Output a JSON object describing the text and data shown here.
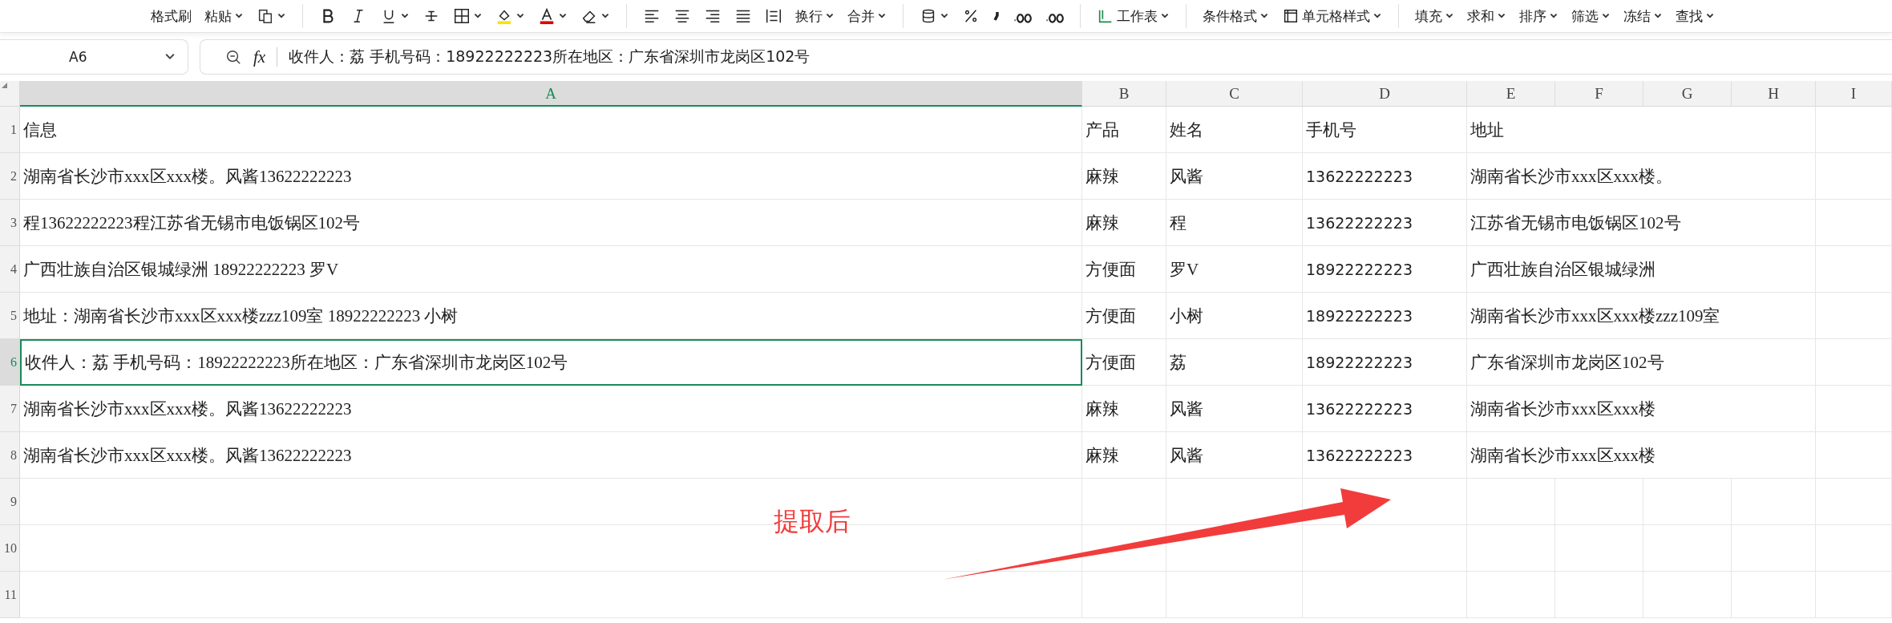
{
  "toolbar": [
    {
      "kind": "text",
      "label": "格式刷",
      "caret": false
    },
    {
      "kind": "text",
      "label": "粘贴",
      "caret": true
    },
    {
      "kind": "paste",
      "caret": true
    },
    {
      "kind": "sep"
    },
    {
      "kind": "bold",
      "caret": false
    },
    {
      "kind": "italic",
      "caret": false
    },
    {
      "kind": "underline",
      "caret": true
    },
    {
      "kind": "strike",
      "caret": false
    },
    {
      "kind": "border",
      "caret": true
    },
    {
      "kind": "fill",
      "caret": true
    },
    {
      "kind": "fontcolor",
      "caret": true
    },
    {
      "kind": "eraser",
      "caret": true
    },
    {
      "kind": "sep"
    },
    {
      "kind": "alignleft",
      "caret": false
    },
    {
      "kind": "aligncenter",
      "caret": false
    },
    {
      "kind": "alignright",
      "caret": false
    },
    {
      "kind": "justify",
      "caret": false
    },
    {
      "kind": "distribute",
      "caret": false
    },
    {
      "kind": "text",
      "label": "换行",
      "caret": true
    },
    {
      "kind": "text",
      "label": "合并",
      "caret": true
    },
    {
      "kind": "sep"
    },
    {
      "kind": "stack",
      "caret": true
    },
    {
      "kind": "percent",
      "caret": false
    },
    {
      "kind": "comma",
      "caret": false
    },
    {
      "kind": "decimal",
      "caret": false
    },
    {
      "kind": "decimal",
      "caret": false
    },
    {
      "kind": "sep"
    },
    {
      "kind": "sheet",
      "label": "工作表",
      "caret": true
    },
    {
      "kind": "sep"
    },
    {
      "kind": "text",
      "label": "条件格式",
      "caret": true
    },
    {
      "kind": "cellstyle",
      "label": "单元格样式",
      "caret": true
    },
    {
      "kind": "sep"
    },
    {
      "kind": "text",
      "label": "填充",
      "caret": true
    },
    {
      "kind": "text",
      "label": "求和",
      "caret": true
    },
    {
      "kind": "text",
      "label": "排序",
      "caret": true
    },
    {
      "kind": "text",
      "label": "筛选",
      "caret": true
    },
    {
      "kind": "text",
      "label": "冻结",
      "caret": true
    },
    {
      "kind": "text",
      "label": "查找",
      "caret": true
    }
  ],
  "name_box": "A6",
  "formula": {
    "fx": "fx",
    "value": "收件人：荔 手机号码：18922222223所在地区：广东省深圳市龙岗区102号"
  },
  "columns": [
    {
      "label": "A",
      "selected": true
    },
    {
      "label": "B",
      "selected": false
    },
    {
      "label": "C",
      "selected": false
    },
    {
      "label": "D",
      "selected": false
    },
    {
      "label": "E",
      "selected": false
    },
    {
      "label": "F",
      "selected": false
    },
    {
      "label": "G",
      "selected": false
    },
    {
      "label": "H",
      "selected": false
    },
    {
      "label": "I",
      "selected": false
    }
  ],
  "rows": [
    {
      "number": "1",
      "selected": false,
      "cells": [
        "信息",
        "产品",
        "姓名",
        "手机号",
        "地址"
      ]
    },
    {
      "number": "2",
      "selected": false,
      "cells": [
        "湖南省长沙市xxx区xxx楼。风酱13622222223",
        "麻辣",
        "风酱",
        "13622222223",
        "湖南省长沙市xxx区xxx楼。"
      ]
    },
    {
      "number": "3",
      "selected": false,
      "cells": [
        "程13622222223程江苏省无锡市电饭锅区102号",
        "麻辣",
        "程",
        "13622222223",
        "江苏省无锡市电饭锅区102号"
      ]
    },
    {
      "number": "4",
      "selected": false,
      "cells": [
        "广西壮族自治区银城绿洲 18922222223 罗V",
        "方便面",
        "罗V",
        "18922222223",
        "广西壮族自治区银城绿洲"
      ]
    },
    {
      "number": "5",
      "selected": false,
      "cells": [
        "地址：湖南省长沙市xxx区xxx楼zzz109室    18922222223 小树",
        "方便面",
        "小树",
        "18922222223",
        "湖南省长沙市xxx区xxx楼zzz109室"
      ]
    },
    {
      "number": "6",
      "selected": true,
      "cells": [
        "收件人：荔 手机号码：18922222223所在地区：广东省深圳市龙岗区102号",
        "方便面",
        "荔",
        "18922222223",
        "广东省深圳市龙岗区102号"
      ]
    },
    {
      "number": "7",
      "selected": false,
      "cells": [
        "湖南省长沙市xxx区xxx楼。风酱13622222223",
        "麻辣",
        "风酱",
        "13622222223",
        "湖南省长沙市xxx区xxx楼"
      ]
    },
    {
      "number": "8",
      "selected": false,
      "cells": [
        "湖南省长沙市xxx区xxx楼。风酱13622222223",
        "麻辣",
        "风酱",
        "13622222223",
        "湖南省长沙市xxx区xxx楼"
      ]
    },
    {
      "number": "9",
      "selected": false
    },
    {
      "number": "10",
      "selected": false
    },
    {
      "number": "11",
      "selected": false
    }
  ],
  "annotation": {
    "text": "提取后"
  }
}
